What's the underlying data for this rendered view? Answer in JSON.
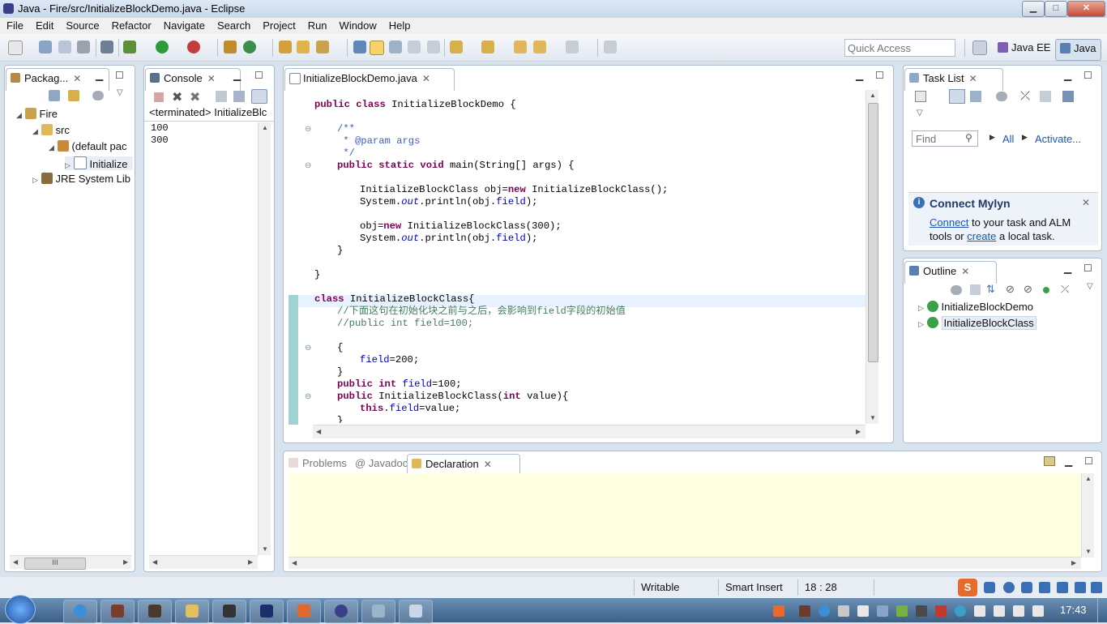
{
  "window": {
    "title": "Java - Fire/src/InitializeBlockDemo.java - Eclipse",
    "min": "▁",
    "max": "□",
    "close": "✕"
  },
  "menu": [
    "File",
    "Edit",
    "Source",
    "Refactor",
    "Navigate",
    "Search",
    "Project",
    "Run",
    "Window",
    "Help"
  ],
  "toolbar": {
    "quick_access_placeholder": "Quick Access",
    "perspective_javaee": "Java EE",
    "perspective_java": "Java"
  },
  "package_explorer": {
    "tab": "Packag...",
    "tree": [
      {
        "label": "Fire",
        "icon": "project-icon"
      },
      {
        "label": "src",
        "icon": "source-folder-icon"
      },
      {
        "label": "(default pac",
        "icon": "package-icon"
      },
      {
        "label": "Initialize",
        "icon": "java-file-icon"
      },
      {
        "label": "JRE System Lib",
        "icon": "library-icon"
      }
    ],
    "scroll_thumb_label": "III"
  },
  "console": {
    "tab": "Console",
    "header": "<terminated> InitializeBlc",
    "output": [
      "100",
      "300"
    ]
  },
  "editor": {
    "tab": "InitializeBlockDemo.java",
    "lines": [
      {
        "indent": 0,
        "segs": [
          {
            "c": "kw",
            "t": "public class"
          },
          {
            "c": "",
            "t": " InitializeBlockDemo {"
          }
        ]
      },
      {
        "indent": 0,
        "segs": []
      },
      {
        "indent": 1,
        "segs": [
          {
            "c": "cm",
            "t": "/**"
          }
        ]
      },
      {
        "indent": 1,
        "segs": [
          {
            "c": "cm",
            "t": " * @param args"
          }
        ]
      },
      {
        "indent": 1,
        "segs": [
          {
            "c": "cm",
            "t": " */"
          }
        ]
      },
      {
        "indent": 1,
        "segs": [
          {
            "c": "kw",
            "t": "public static void"
          },
          {
            "c": "",
            "t": " main(String[] args) {"
          }
        ]
      },
      {
        "indent": 0,
        "segs": []
      },
      {
        "indent": 2,
        "segs": [
          {
            "c": "",
            "t": "InitializeBlockClass obj="
          },
          {
            "c": "kw",
            "t": "new"
          },
          {
            "c": "",
            "t": " InitializeBlockClass();"
          }
        ]
      },
      {
        "indent": 2,
        "segs": [
          {
            "c": "",
            "t": "System."
          },
          {
            "c": "fd it",
            "t": "out"
          },
          {
            "c": "",
            "t": ".println(obj."
          },
          {
            "c": "fd",
            "t": "field"
          },
          {
            "c": "",
            "t": ");"
          }
        ]
      },
      {
        "indent": 0,
        "segs": []
      },
      {
        "indent": 2,
        "segs": [
          {
            "c": "",
            "t": "obj="
          },
          {
            "c": "kw",
            "t": "new"
          },
          {
            "c": "",
            "t": " InitializeBlockClass(300);"
          }
        ]
      },
      {
        "indent": 2,
        "segs": [
          {
            "c": "",
            "t": "System."
          },
          {
            "c": "fd it",
            "t": "out"
          },
          {
            "c": "",
            "t": ".println(obj."
          },
          {
            "c": "fd",
            "t": "field"
          },
          {
            "c": "",
            "t": ");"
          }
        ]
      },
      {
        "indent": 1,
        "segs": [
          {
            "c": "",
            "t": "}"
          }
        ]
      },
      {
        "indent": 0,
        "segs": []
      },
      {
        "indent": 0,
        "segs": [
          {
            "c": "",
            "t": "}"
          }
        ]
      },
      {
        "indent": 0,
        "segs": []
      },
      {
        "indent": 0,
        "segs": [
          {
            "c": "kw",
            "t": "class"
          },
          {
            "c": "",
            "t": " InitializeBlockClass{"
          }
        ]
      },
      {
        "indent": 1,
        "segs": [
          {
            "c": "lc",
            "t": "//下面这句在初始化块之前与之后，会影响到field字段的初始值"
          }
        ]
      },
      {
        "indent": 1,
        "segs": [
          {
            "c": "lc",
            "t": "//public int field=100;"
          }
        ]
      },
      {
        "indent": 0,
        "segs": []
      },
      {
        "indent": 1,
        "segs": [
          {
            "c": "",
            "t": "{"
          }
        ]
      },
      {
        "indent": 2,
        "segs": [
          {
            "c": "fd",
            "t": "field"
          },
          {
            "c": "",
            "t": "=200;"
          }
        ]
      },
      {
        "indent": 1,
        "segs": [
          {
            "c": "",
            "t": "}"
          }
        ]
      },
      {
        "indent": 1,
        "segs": [
          {
            "c": "kw",
            "t": "public int"
          },
          {
            "c": "",
            "t": " "
          },
          {
            "c": "fd",
            "t": "field"
          },
          {
            "c": "",
            "t": "=100;"
          }
        ]
      },
      {
        "indent": 1,
        "segs": [
          {
            "c": "kw",
            "t": "public"
          },
          {
            "c": "",
            "t": " InitializeBlockClass("
          },
          {
            "c": "kw",
            "t": "int"
          },
          {
            "c": "",
            "t": " value){"
          }
        ]
      },
      {
        "indent": 2,
        "segs": [
          {
            "c": "kw",
            "t": "this"
          },
          {
            "c": "",
            "t": "."
          },
          {
            "c": "fd",
            "t": "field"
          },
          {
            "c": "",
            "t": "=value;"
          }
        ]
      },
      {
        "indent": 1,
        "segs": [
          {
            "c": "",
            "t": "}"
          }
        ]
      }
    ]
  },
  "task_list": {
    "tab": "Task List",
    "find_placeholder": "Find",
    "all": "All",
    "activate": "Activate..."
  },
  "mylyn": {
    "title": "Connect Mylyn",
    "connect": "Connect",
    "text1": " to your task and ALM",
    "text2": "tools or ",
    "create": "create",
    "text3": " a local task."
  },
  "outline": {
    "tab": "Outline",
    "items": [
      "InitializeBlockDemo",
      "InitializeBlockClass"
    ]
  },
  "bottom": {
    "tabs": [
      "Problems",
      "@ Javadoc",
      "Declaration"
    ]
  },
  "status": {
    "writable": "Writable",
    "insert": "Smart Insert",
    "position": "18 : 28"
  },
  "taskbar": {
    "time": "17:43"
  },
  "colors": {
    "keyword": "#7f0055",
    "comment": "#3f5fbf",
    "line_comment": "#3f7f5f",
    "field": "#0000c0",
    "declaration_bg": "#ffffe1"
  }
}
